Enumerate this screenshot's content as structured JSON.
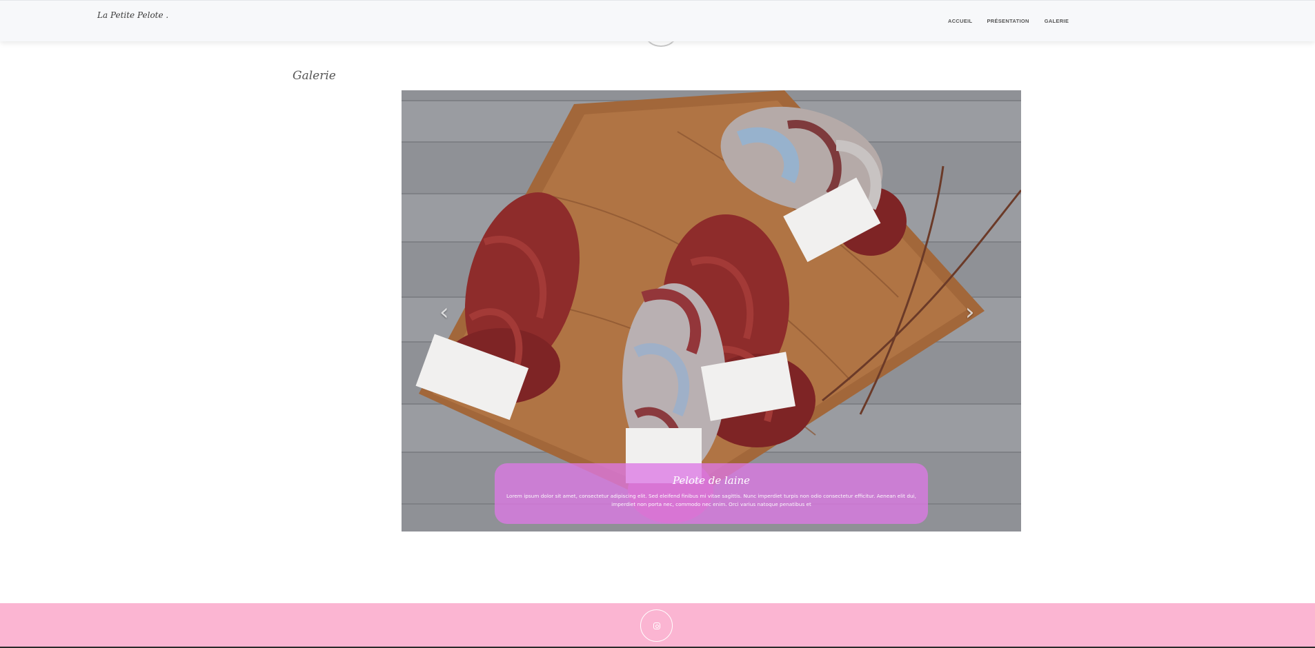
{
  "navbar": {
    "brand": "La Petite Pelote .",
    "links": [
      {
        "label": "ACCUEIL"
      },
      {
        "label": "PRÉSENTATION"
      },
      {
        "label": "GALERIE"
      }
    ]
  },
  "gallery": {
    "title": "Galerie",
    "slide": {
      "title": "Pelote de laine",
      "text": "Lorem ipsum dolor sit amet, consectetur adipiscing elit. Sed eleifend finibus mi vitae sagittis. Nunc imperdiet turpis non odio consectetur efficitur. Aenean elit dui, imperdiet non porta nec, commodo nec enim. Orci varius natoque penatibus et"
    },
    "controls": {
      "prev": "‹",
      "next": "›"
    }
  },
  "footer": {
    "icon": "instagram-icon"
  },
  "colors": {
    "navbar_bg": "#f7f8fa",
    "caption_bg": "#dc78e4",
    "footer_bg": "#fbb5d2"
  }
}
